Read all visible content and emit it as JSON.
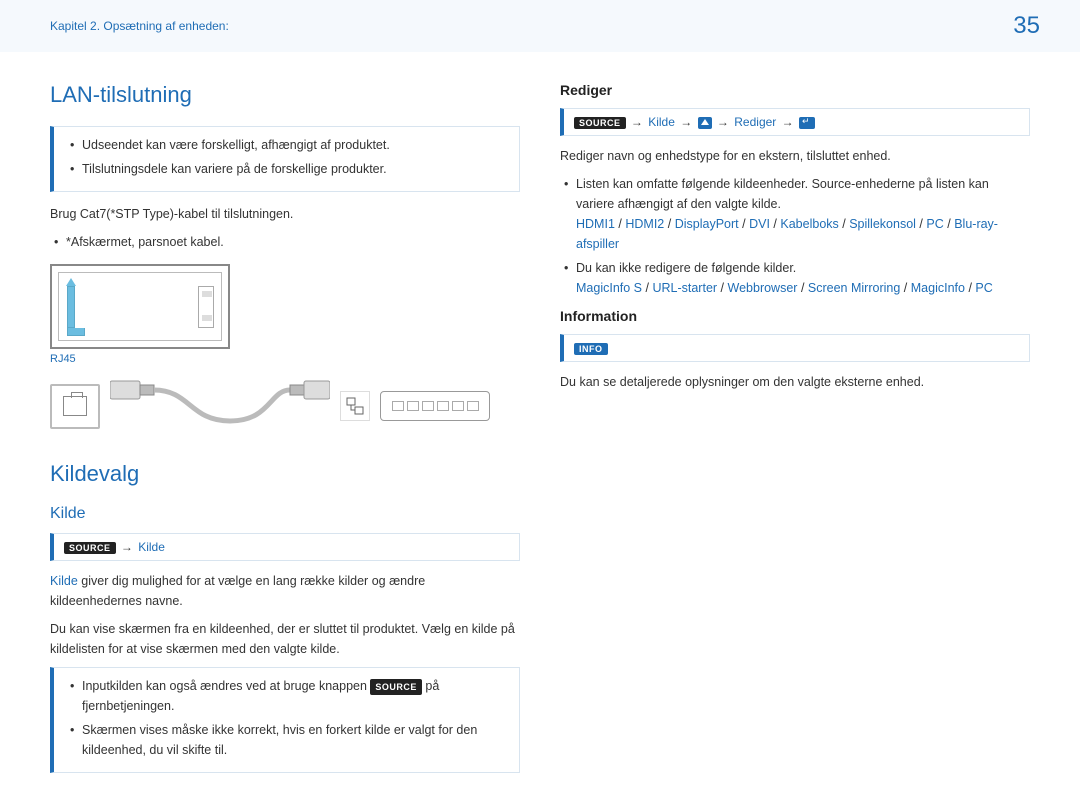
{
  "header": {
    "breadcrumb": "Kapitel 2. Opsætning af enheden:",
    "page_number": "35"
  },
  "left": {
    "h1_lan": "LAN-tilslutning",
    "note_items": [
      "Udseendet kan være forskelligt, afhængigt af produktet.",
      "Tilslutningsdele kan variere på de forskellige produkter."
    ],
    "lan_cable_text": "Brug Cat7(*STP Type)-kabel til tilslutningen.",
    "lan_sub_item": "*Afskærmet, parsnoet kabel.",
    "rj45_label": "RJ45",
    "h1_kildevalg": "Kildevalg",
    "h2_kilde": "Kilde",
    "path_kilde": {
      "source": "SOURCE",
      "kilde": "Kilde"
    },
    "kilde_para_lead": "Kilde",
    "kilde_para_rest": " giver dig mulighed for at vælge en lang række kilder og ændre kildeenhedernes navne.",
    "kilde_para2": "Du kan vise skærmen fra en kildeenhed, der er sluttet til produktet. Vælg en kilde på kildelisten for at vise skærmen med den valgte kilde.",
    "kilde_bullets": {
      "b1_pre": "Inputkilden kan også ændres ved at bruge knappen ",
      "b1_badge": "SOURCE",
      "b1_post": " på fjernbetjeningen.",
      "b2": "Skærmen vises måske ikke korrekt, hvis en forkert kilde er valgt for den kildeenhed, du vil skifte til."
    }
  },
  "right": {
    "h3_rediger": "Rediger",
    "rediger_path": {
      "source": "SOURCE",
      "kilde": "Kilde",
      "rediger": "Rediger"
    },
    "rediger_para": "Rediger navn og enhedstype for en ekstern, tilsluttet enhed.",
    "rediger_b1": "Listen kan omfatte følgende kildeenheder. Source-enhederne på listen kan variere afhængigt af den valgte kilde.",
    "rediger_list1": [
      "HDMI1",
      "HDMI2",
      "DisplayPort",
      "DVI",
      "Kabelboks",
      "Spillekonsol",
      "PC",
      "Blu-ray-afspiller"
    ],
    "rediger_b2": "Du kan ikke redigere de følgende kilder.",
    "rediger_list2": [
      "MagicInfo S",
      "URL-starter",
      "Webbrowser",
      "Screen Mirroring",
      "MagicInfo",
      "PC"
    ],
    "h3_info": "Information",
    "info_badge": "INFO",
    "info_para": "Du kan se detaljerede oplysninger om den valgte eksterne enhed."
  }
}
